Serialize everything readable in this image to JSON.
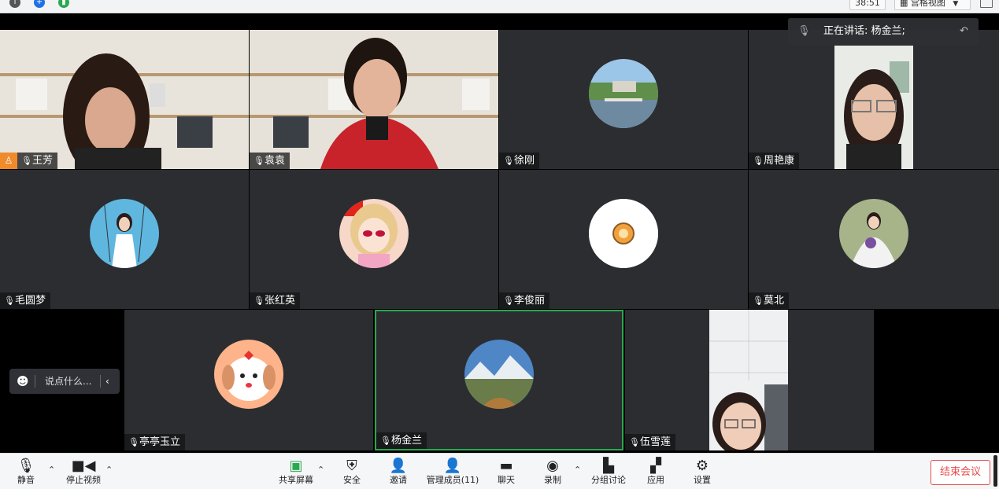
{
  "window": {
    "timer": "38:51",
    "view_mode": "宫格视图",
    "accent": "#2aa84f",
    "status_colors": {
      "info": "#555555",
      "shield": "#1f6fe5",
      "signal": "#2aa84f"
    }
  },
  "speaking": {
    "label": "正在讲话: 杨金兰;"
  },
  "participants": [
    {
      "name": "王芳",
      "mic": "on"
    },
    {
      "name": "袁袁",
      "mic": "muted"
    },
    {
      "name": "徐刚",
      "mic": "on"
    },
    {
      "name": "周艳康",
      "mic": "muted"
    },
    {
      "name": "毛圆梦",
      "mic": "muted"
    },
    {
      "name": "张红英",
      "mic": "muted"
    },
    {
      "name": "李俊丽",
      "mic": "on"
    },
    {
      "name": "莫北",
      "mic": "muted"
    },
    {
      "name": "亭亭玉立",
      "mic": "muted"
    },
    {
      "name": "杨金兰",
      "mic": "on",
      "active": true
    },
    {
      "name": "伍雪莲",
      "mic": "muted"
    }
  ],
  "chat": {
    "placeholder": "说点什么..."
  },
  "toolbar": {
    "mute": "静音",
    "stop_video": "停止视频",
    "share_screen": "共享屏幕",
    "security": "安全",
    "invite": "邀请",
    "manage_members": "管理成员(11)",
    "chat": "聊天",
    "record": "录制",
    "breakout": "分组讨论",
    "apps": "应用",
    "settings": "设置",
    "end_meeting": "结束会议"
  }
}
